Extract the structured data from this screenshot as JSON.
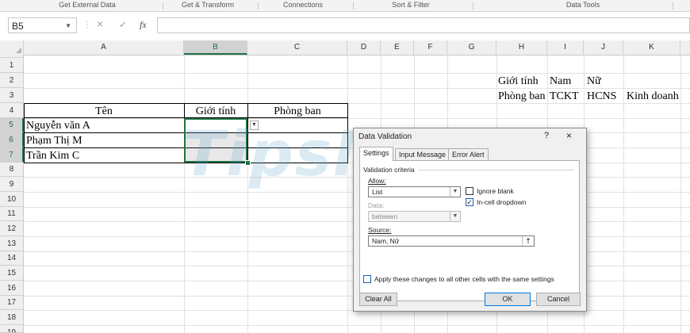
{
  "ribbon": {
    "groups": [
      "Get External Data",
      "Get & Transform",
      "Connections",
      "Sort & Filter",
      "Data Tools"
    ]
  },
  "formula_bar": {
    "name_box": "B5",
    "cancel_glyph": "×",
    "enter_glyph": "✓",
    "fx_glyph": "fx",
    "value": ""
  },
  "columns": [
    "A",
    "B",
    "C",
    "D",
    "E",
    "F",
    "G",
    "H",
    "I",
    "J",
    "K"
  ],
  "rows": [
    "1",
    "2",
    "3",
    "4",
    "5",
    "6",
    "7",
    "8",
    "9",
    "10",
    "11",
    "12",
    "13",
    "14",
    "15",
    "16",
    "17",
    "18",
    "19"
  ],
  "cells": {
    "H2": "Giới tính",
    "I2": "Nam",
    "J2": "Nữ",
    "H3": "Phòng ban",
    "I3": "TCKT",
    "J3": "HCNS",
    "K3": "Kinh doanh",
    "A4": "Tên",
    "B4": "Giới tính",
    "C4": "Phòng ban",
    "A5": "Nguyễn văn A",
    "A6": "Phạm Thị M",
    "A7": "Trần Kim C"
  },
  "watermark": "TipsMake",
  "dialog": {
    "title": "Data Validation",
    "help": "?",
    "close": "×",
    "tabs": [
      "Settings",
      "Input Message",
      "Error Alert"
    ],
    "section_label": "Validation criteria",
    "allow_label": "Allow:",
    "allow_value": "List",
    "data_label": "Data:",
    "data_value": "between",
    "ignore_blank_label": "Ignore blank",
    "ignore_blank_checked": false,
    "in_cell_dropdown_label": "In-cell dropdown",
    "in_cell_dropdown_checked": true,
    "source_label": "Source:",
    "source_value": "Nam, Nữ",
    "apply_all_label": "Apply these changes to all other cells with the same settings",
    "apply_all_checked": false,
    "clear_all_label": "Clear All",
    "ok_label": "OK",
    "cancel_label": "Cancel"
  }
}
